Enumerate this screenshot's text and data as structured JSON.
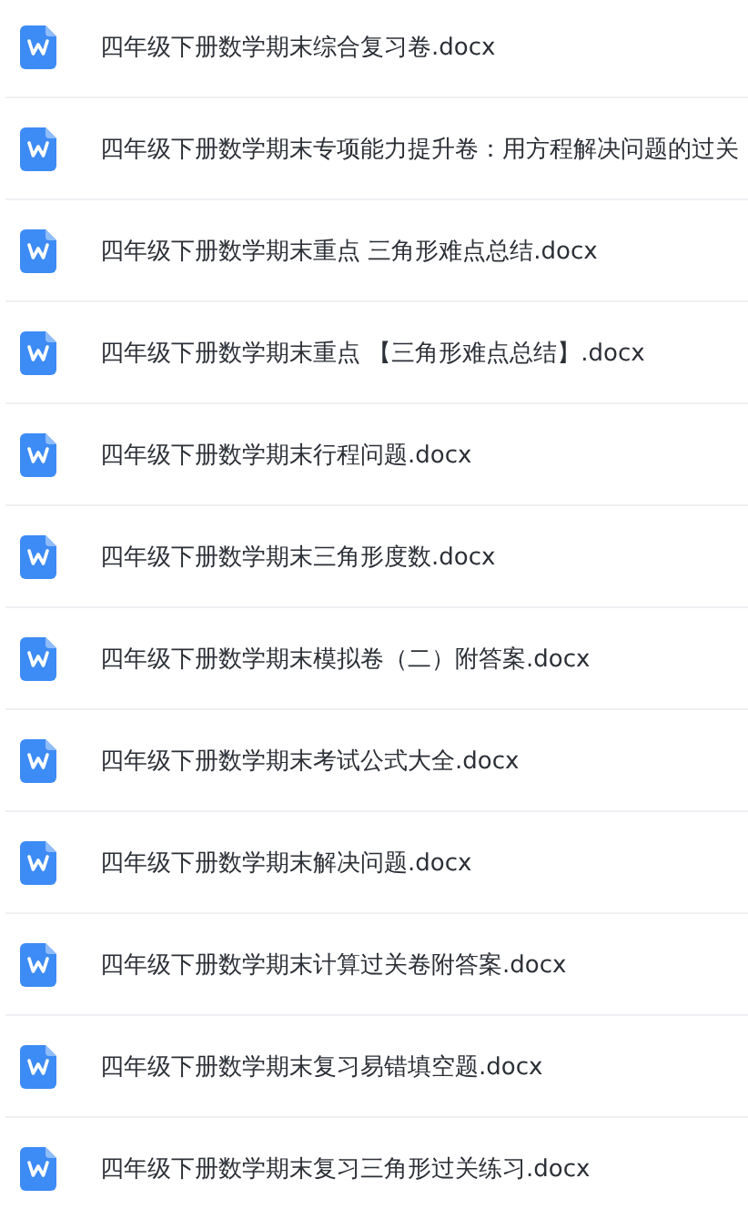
{
  "files": [
    {
      "name": "四年级下册数学期末综合复习卷.docx"
    },
    {
      "name": "四年级下册数学期末专项能力提升卷：用方程解决问题的过关"
    },
    {
      "name": "四年级下册数学期末重点 三角形难点总结.docx"
    },
    {
      "name": "四年级下册数学期末重点 【三角形难点总结】.docx"
    },
    {
      "name": "四年级下册数学期末行程问题.docx"
    },
    {
      "name": "四年级下册数学期末三角形度数.docx"
    },
    {
      "name": "四年级下册数学期末模拟卷（二）附答案.docx"
    },
    {
      "name": "四年级下册数学期末考试公式大全.docx"
    },
    {
      "name": "四年级下册数学期末解决问题.docx"
    },
    {
      "name": "四年级下册数学期末计算过关卷附答案.docx"
    },
    {
      "name": "四年级下册数学期末复习易错填空题.docx"
    },
    {
      "name": "四年级下册数学期末复习三角形过关练习.docx"
    }
  ]
}
